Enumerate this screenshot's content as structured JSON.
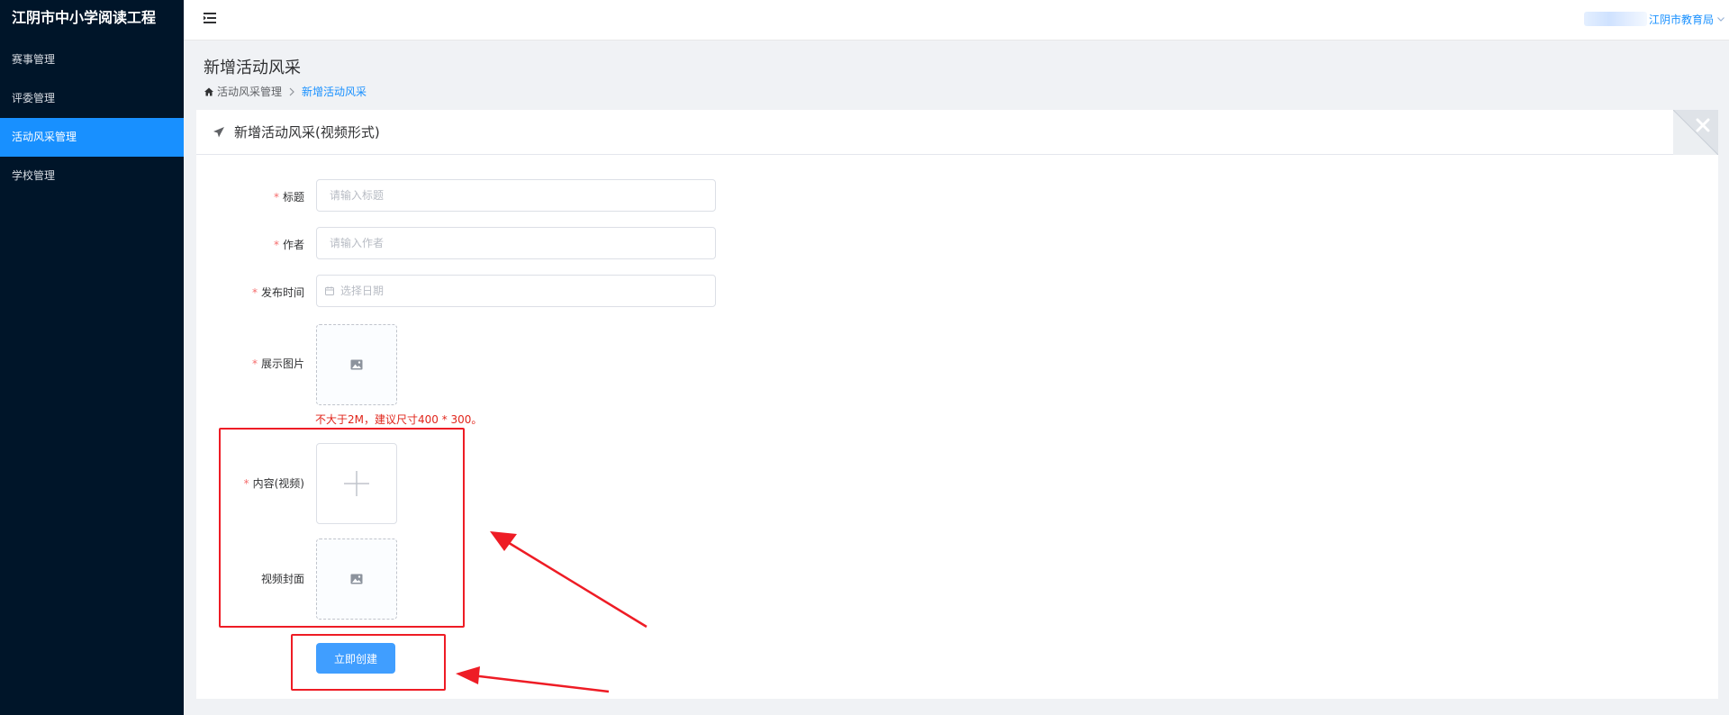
{
  "app": {
    "title": "江阴市中小学阅读工程"
  },
  "sidebar": {
    "items": [
      {
        "label": "赛事管理",
        "active": false
      },
      {
        "label": "评委管理",
        "active": false
      },
      {
        "label": "活动风采管理",
        "active": true
      },
      {
        "label": "学校管理",
        "active": false
      }
    ]
  },
  "header": {
    "user_name": "江阴市教育局",
    "menu_icon": "menu-fold-icon"
  },
  "page": {
    "title": "新增活动风采",
    "breadcrumb": {
      "home": "活动风采管理",
      "current": "新增活动风采"
    }
  },
  "card": {
    "title": "新增活动风采(视频形式)",
    "header_icon": "send-icon",
    "close_icon": "close-icon"
  },
  "form": {
    "required_mark": "*",
    "title": {
      "label": "标题",
      "placeholder": "请输入标题",
      "value": ""
    },
    "author": {
      "label": "作者",
      "placeholder": "请输入作者",
      "value": ""
    },
    "publish_time": {
      "label": "发布时间",
      "placeholder": "选择日期",
      "value": ""
    },
    "display_image": {
      "label": "展示图片",
      "hint": "不大于2M，建议尺寸400 * 300。"
    },
    "content_video": {
      "label": "内容(视频)"
    },
    "video_cover": {
      "label": "视频封面"
    },
    "submit_label": "立即创建"
  },
  "colors": {
    "sidebar_bg": "#001529",
    "active_nav": "#1890ff",
    "primary_button": "#409eff",
    "required": "#f56c6c",
    "hint_text": "#e1251b",
    "annotation": "#ee1c25"
  }
}
